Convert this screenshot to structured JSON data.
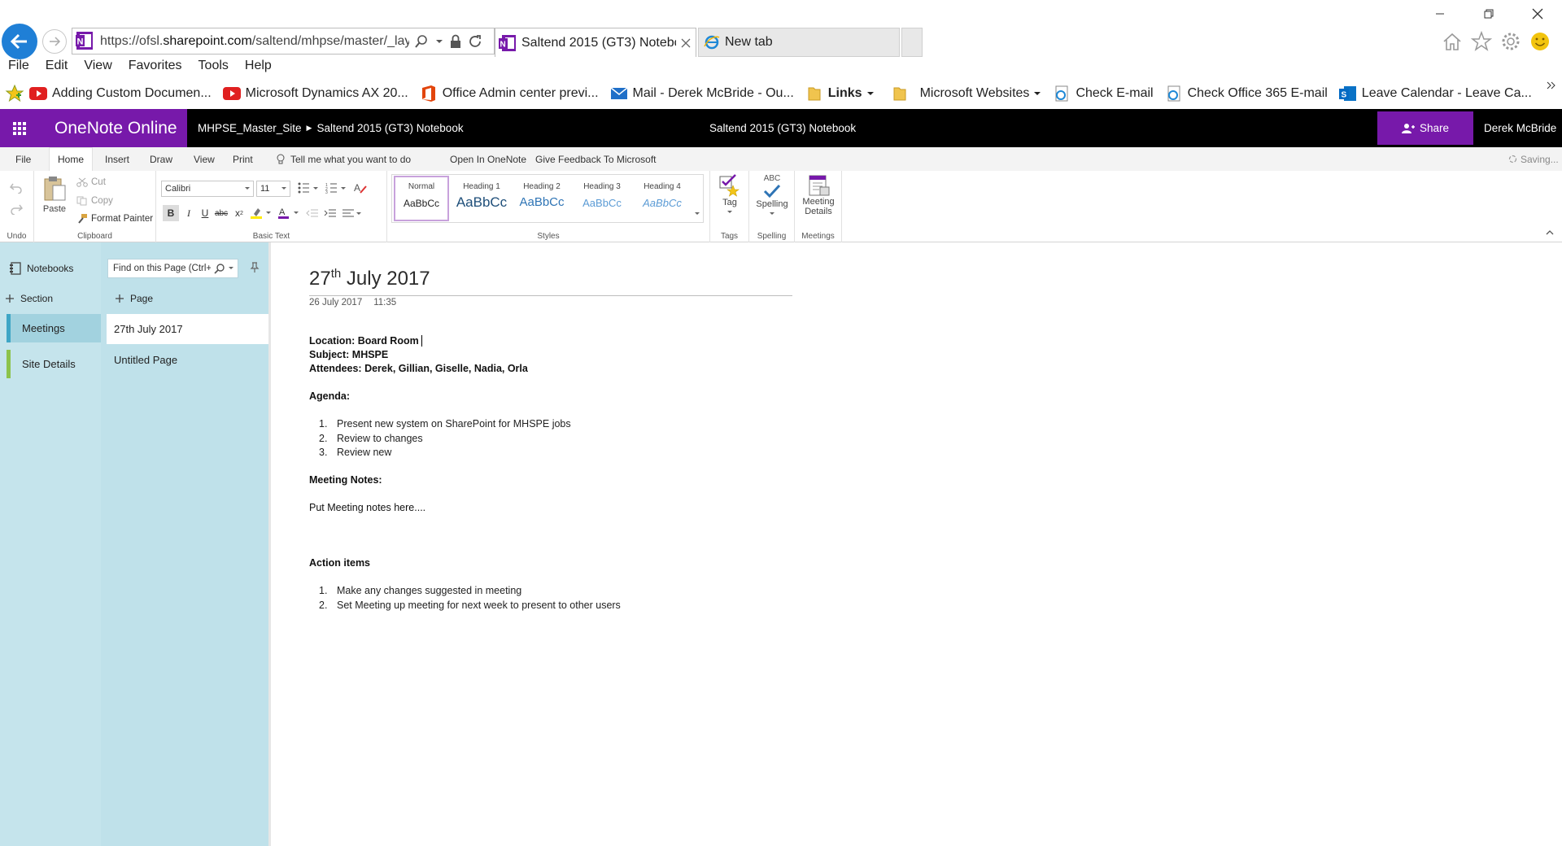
{
  "browser": {
    "url_prefix": "https://ofsl.",
    "url_domain": "sharepoint.com",
    "url_path": "/saltend/mhpse/master/_layou",
    "tabs": [
      {
        "label": "Saltend 2015 (GT3) Notebo...",
        "active": true
      },
      {
        "label": "New tab",
        "active": false
      }
    ],
    "menu": [
      "File",
      "Edit",
      "View",
      "Favorites",
      "Tools",
      "Help"
    ],
    "favorites": [
      "Adding Custom Documen...",
      "Microsoft Dynamics AX 20...",
      "Office Admin center previ...",
      "Mail - Derek McBride - Ou...",
      "Links",
      "Microsoft Websites",
      "Check E-mail",
      "Check Office 365 E-mail",
      "Leave Calendar - Leave Ca..."
    ]
  },
  "app": {
    "name": "OneNote Online",
    "breadcrumb_site": "MHPSE_Master_Site",
    "breadcrumb_notebook": "Saltend 2015 (GT3) Notebook",
    "doc_title": "Saltend 2015 (GT3) Notebook",
    "share_label": "Share",
    "user_name": "Derek McBride",
    "accent_color": "#7719aa"
  },
  "ribbon_tabs": {
    "file": "File",
    "home": "Home",
    "insert": "Insert",
    "draw": "Draw",
    "view": "View",
    "print": "Print",
    "tellme": "Tell me what you want to do",
    "open_in": "Open In OneNote",
    "feedback": "Give Feedback To Microsoft",
    "status": "Saving..."
  },
  "ribbon": {
    "undo_group": "Undo",
    "paste": "Paste",
    "cut": "Cut",
    "copy": "Copy",
    "format_painter": "Format Painter",
    "clipboard_group": "Clipboard",
    "font_name": "Calibri",
    "font_size": "11",
    "basic_text_group": "Basic Text",
    "styles": [
      {
        "name": "Normal",
        "sample": "AaBbCc"
      },
      {
        "name": "Heading 1",
        "sample": "AaBbCc"
      },
      {
        "name": "Heading 2",
        "sample": "AaBbCc"
      },
      {
        "name": "Heading 3",
        "sample": "AaBbCc"
      },
      {
        "name": "Heading 4",
        "sample": "AaBbCc"
      }
    ],
    "styles_group": "Styles",
    "tag": "Tag",
    "tags_group": "Tags",
    "spelling": "Spelling",
    "spelling_group": "Spelling",
    "abc": "ABC",
    "meeting_details_1": "Meeting",
    "meeting_details_2": "Details",
    "meetings_group": "Meetings"
  },
  "nav": {
    "notebooks": "Notebooks",
    "add_section": "Section",
    "sections": [
      "Meetings",
      "Site Details"
    ],
    "find_placeholder": "Find on this Page (Ctrl+",
    "add_page": "Page",
    "pages": [
      "27th July 2017",
      "Untitled Page"
    ]
  },
  "page": {
    "title_day": "27",
    "title_sup": "th",
    "title_rest": " July 2017",
    "date": "26 July 2017",
    "time": "11:35",
    "location": "Location: Board Room",
    "subject": "Subject: MHSPE",
    "attendees": "Attendees: Derek, Gillian, Giselle, Nadia, Orla",
    "agenda_heading": "Agenda:",
    "agenda": [
      {
        "n": "1.",
        "text": "Present new system on SharePoint for MHSPE jobs"
      },
      {
        "n": "2.",
        "text": "Review to changes"
      },
      {
        "n": "3.",
        "text": "Review new"
      }
    ],
    "notes_heading": "Meeting Notes:",
    "notes_text": "Put Meeting notes here....",
    "actions_heading": "Action items",
    "actions": [
      {
        "n": "1.",
        "text": "Make any changes suggested in meeting"
      },
      {
        "n": "2.",
        "text": "Set Meeting up meeting for next week to present to other users"
      }
    ]
  }
}
